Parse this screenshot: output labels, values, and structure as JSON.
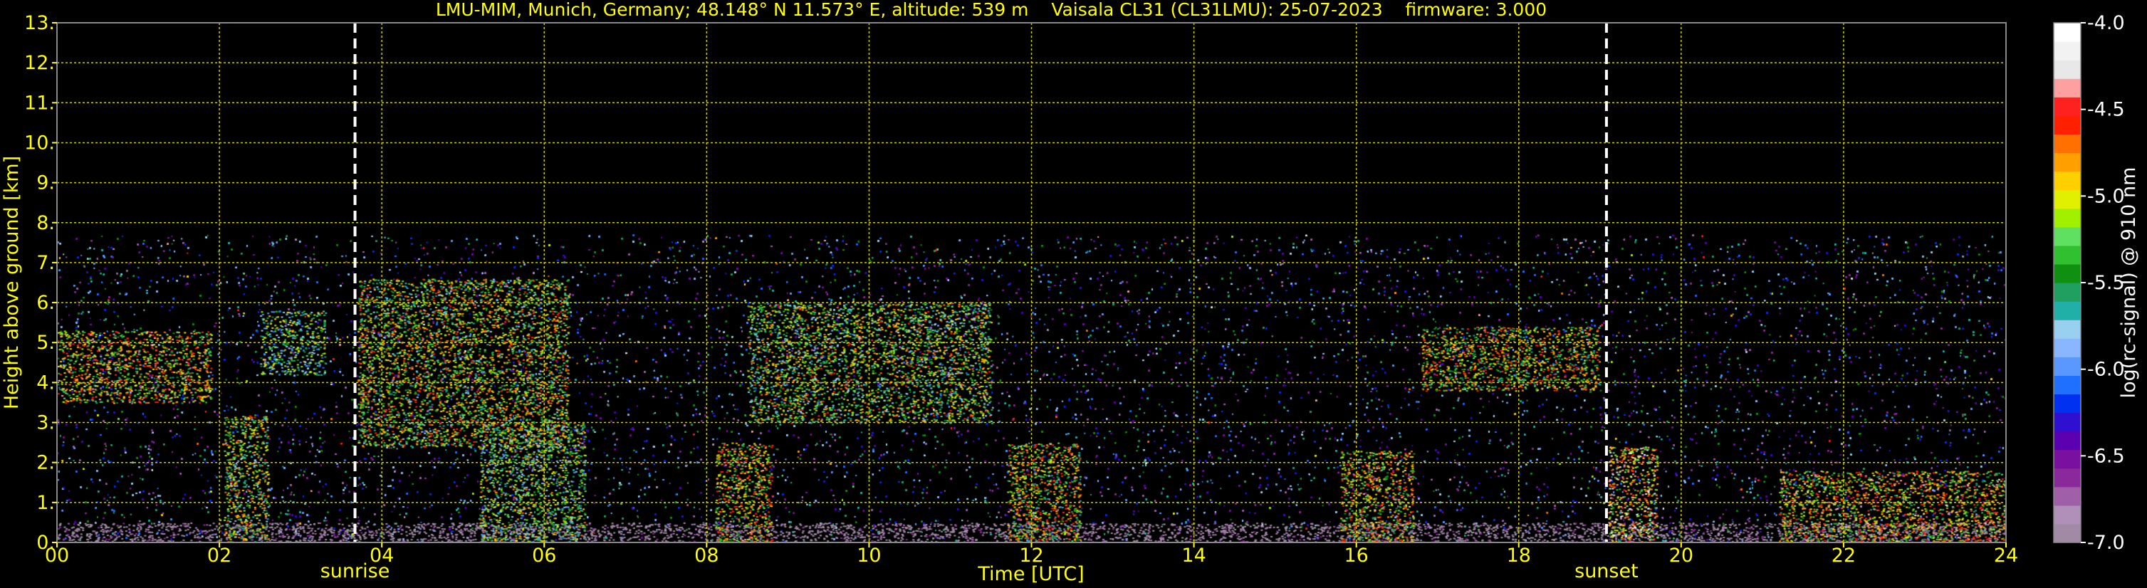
{
  "title": "LMU-MIM, Munich, Germany; 48.148° N 11.573° E, altitude: 539 m    Vaisala CL31 (CL31LMU): 25-07-2023    firmware: 3.000",
  "colors": {
    "text": "#ffff00",
    "grid": "#cccc00",
    "background": "#000000",
    "marker_lines": "#ffffff",
    "colorbar_label": "#ffffff"
  },
  "chart_data": {
    "type": "heatmap",
    "title": "LMU-MIM, Munich, Germany; 48.148° N 11.573° E, altitude: 539 m    Vaisala CL31 (CL31LMU): 25-07-2023    firmware: 3.000",
    "xlabel": "Time [UTC]",
    "ylabel": "Height above ground [km]",
    "xlim": [
      0,
      24
    ],
    "ylim": [
      0,
      13
    ],
    "x_ticks": [
      0,
      2,
      4,
      6,
      8,
      10,
      12,
      14,
      16,
      18,
      20,
      22,
      24
    ],
    "x_tick_labels": [
      "00",
      "02",
      "04",
      "06",
      "08",
      "10",
      "12",
      "14",
      "16",
      "18",
      "20",
      "22",
      "24"
    ],
    "y_ticks": [
      0,
      1,
      2,
      3,
      4,
      5,
      6,
      7,
      8,
      9,
      10,
      11,
      12,
      13
    ],
    "y_tick_labels": [
      "0.",
      "1.",
      "2.",
      "3.",
      "4.",
      "5.",
      "6.",
      "7.",
      "8.",
      "9.",
      "10.",
      "11.",
      "12.",
      "13."
    ],
    "grid": true,
    "data_ceiling_km": 7.7,
    "markers": [
      {
        "label": "sunrise",
        "time_utc": 3.67
      },
      {
        "label": "sunset",
        "time_utc": 19.08
      }
    ],
    "colorbar": {
      "label": "log(rc-signal) @ 910 nm",
      "range": [
        -7.0,
        -4.0
      ],
      "ticks": [
        -7.0,
        -6.5,
        -6.0,
        -5.5,
        -5.0,
        -4.5,
        -4.0
      ],
      "tick_labels": [
        "-7.0",
        "-6.5",
        "-6.0",
        "-5.5",
        "-5.0",
        "-4.5",
        "-4.0"
      ],
      "colors": [
        "#a08aa4",
        "#b090b8",
        "#a060a8",
        "#8a2a9a",
        "#7a10a0",
        "#5a00b0",
        "#3010d0",
        "#0030f0",
        "#2070ff",
        "#5a98ff",
        "#8ab6ff",
        "#9ad0ef",
        "#20b0a8",
        "#20a060",
        "#109010",
        "#30c030",
        "#60e060",
        "#a0f000",
        "#e0f000",
        "#ffd000",
        "#ffa000",
        "#ff7000",
        "#ff2000",
        "#ff2020",
        "#ffa0a0",
        "#e8e8e8",
        "#f2f2f2",
        "#ffffff"
      ]
    },
    "features": [
      {
        "name": "boundary layer haze",
        "time_start": 0,
        "time_end": 24,
        "height_km": [
          0,
          0.5
        ],
        "log_signal": -6.6
      },
      {
        "name": "aerosol layer 00-02",
        "time_start": 0.0,
        "time_end": 1.9,
        "height_km": [
          3.5,
          5.3
        ],
        "log_signal": -4.3
      },
      {
        "name": "rain plume 02",
        "time_start": 2.05,
        "time_end": 2.6,
        "height_km": [
          0,
          3.2
        ],
        "log_signal": -4.6
      },
      {
        "name": "cloud 02-03",
        "time_start": 2.5,
        "time_end": 3.3,
        "height_km": [
          4.2,
          5.8
        ],
        "log_signal": -4.8
      },
      {
        "name": "descending layer 04-06",
        "time_start": 3.7,
        "time_end": 6.3,
        "height_km": [
          2.4,
          6.6
        ],
        "log_signal": -4.5
      },
      {
        "name": "rain plume 06",
        "time_start": 5.2,
        "time_end": 6.5,
        "height_km": [
          0,
          3.0
        ],
        "log_signal": -4.7
      },
      {
        "name": "rain plume 08",
        "time_start": 8.1,
        "time_end": 8.8,
        "height_km": [
          0,
          2.5
        ],
        "log_signal": -4.3
      },
      {
        "name": "cloud band 09-11",
        "time_start": 8.5,
        "time_end": 11.5,
        "height_km": [
          3.0,
          6.0
        ],
        "log_signal": -4.6
      },
      {
        "name": "convection 12",
        "time_start": 11.7,
        "time_end": 12.6,
        "height_km": [
          0,
          2.5
        ],
        "log_signal": -4.4
      },
      {
        "name": "convection 16",
        "time_start": 15.8,
        "time_end": 16.7,
        "height_km": [
          0,
          2.3
        ],
        "log_signal": -4.3
      },
      {
        "name": "aerosol layer 17-19",
        "time_start": 16.8,
        "time_end": 19.0,
        "height_km": [
          3.8,
          5.4
        ],
        "log_signal": -4.4
      },
      {
        "name": "rain plume 19",
        "time_start": 19.1,
        "time_end": 19.7,
        "height_km": [
          0,
          2.4
        ],
        "log_signal": -4.1
      },
      {
        "name": "low clouds 21-24",
        "time_start": 21.2,
        "time_end": 24,
        "height_km": [
          0,
          1.8
        ],
        "log_signal": -4.3
      }
    ]
  }
}
